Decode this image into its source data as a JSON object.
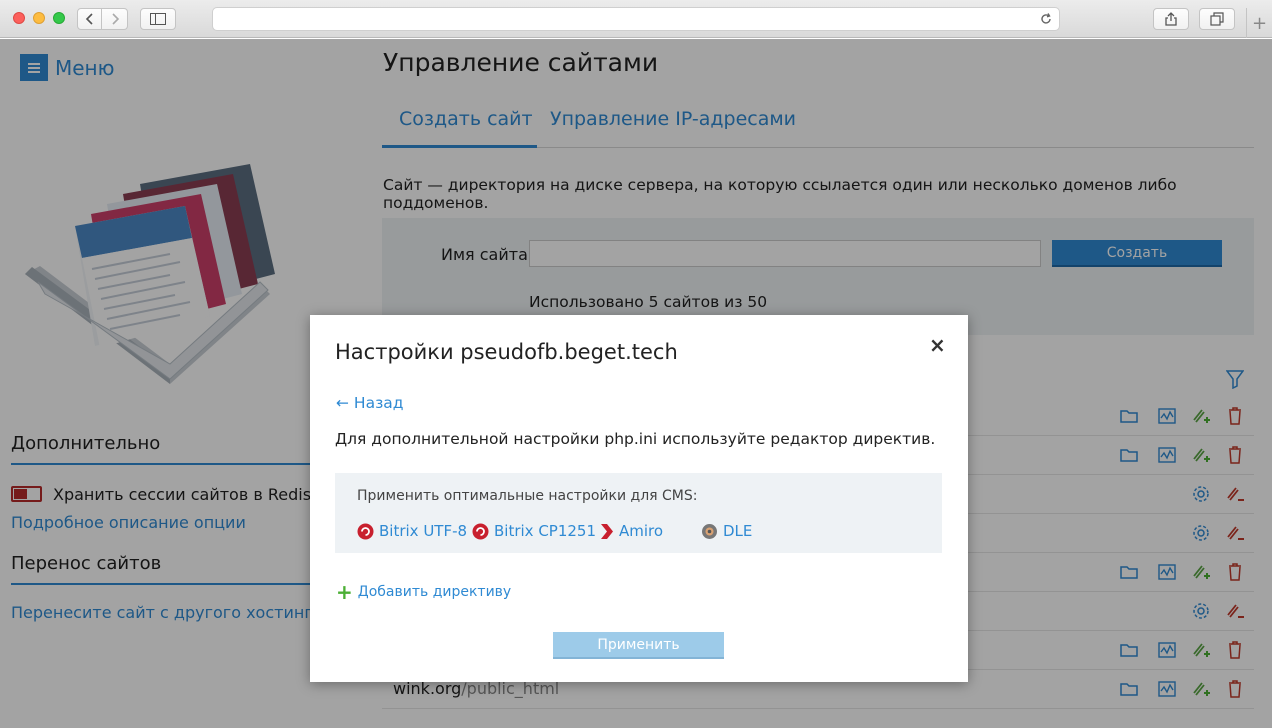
{
  "browser": {
    "address": "",
    "icons": [
      "back-icon",
      "forward-icon",
      "sidebar-icon",
      "reload-icon",
      "share-icon",
      "tabs-icon",
      "new-tab-icon"
    ]
  },
  "sidebar": {
    "menu_label": "Меню",
    "extra_heading": "Дополнительно",
    "redis_label": "Хранить сессии сайтов в Redis",
    "redis_link": "Подробное описание опции",
    "transfer_heading": "Перенос сайтов",
    "transfer_link": "Перенесите сайт с другого хостинга"
  },
  "main": {
    "title": "Управление сайтами",
    "tabs": [
      {
        "label": "Создать сайт",
        "active": true
      },
      {
        "label": "Управление IP-адресами",
        "active": false
      }
    ],
    "description": "Сайт — директория на диске сервера, на которую ссылается один или несколько доменов либо поддоменов.",
    "site_name_label": "Имя сайта:",
    "site_name_value": "",
    "create_button": "Создать",
    "usage": "Использовано 5 сайтов из 50",
    "rows": [
      {
        "name": "",
        "path": "",
        "icons": [
          "folder-icon",
          "stats-icon",
          "add-domain-icon",
          "delete-icon"
        ]
      },
      {
        "name": "",
        "path": "",
        "icons": [
          "folder-icon",
          "stats-icon",
          "add-domain-icon",
          "delete-icon"
        ]
      },
      {
        "name": "",
        "path": "",
        "icons": [
          "settings-icon",
          "remove-domain-icon"
        ]
      },
      {
        "name": "",
        "path": "",
        "icons": [
          "settings-icon",
          "remove-domain-icon"
        ]
      },
      {
        "name": "",
        "path": "",
        "icons": [
          "folder-icon",
          "stats-icon",
          "add-domain-icon",
          "delete-icon"
        ]
      },
      {
        "name": "",
        "path": "",
        "icons": [
          "settings-icon",
          "remove-domain-icon"
        ]
      },
      {
        "name": "",
        "path": "",
        "icons": [
          "folder-icon",
          "stats-icon",
          "add-domain-icon",
          "delete-icon"
        ]
      },
      {
        "name": "wink.org",
        "path": "/public_html",
        "icons": [
          "folder-icon",
          "stats-icon",
          "add-domain-icon",
          "delete-icon"
        ]
      }
    ]
  },
  "modal": {
    "title": "Настройки pseudofb.beget.tech",
    "close": "×",
    "back": "← Назад",
    "description": "Для дополнительной настройки php.ini используйте редактор директив.",
    "cms_label": "Применить оптимальные настройки для CMS:",
    "cms": [
      {
        "label": "Bitrix UTF-8",
        "icon": "bitrix-icon"
      },
      {
        "label": "Bitrix CP1251",
        "icon": "bitrix-icon"
      },
      {
        "label": "Amiro",
        "icon": "amiro-icon"
      },
      {
        "label": "DLE",
        "icon": "dle-icon"
      }
    ],
    "add_directive": "Добавить директиву",
    "apply_button": "Применить"
  },
  "colors": {
    "accent": "#2f8ad3",
    "danger": "#c0392b",
    "success": "#4caf35",
    "panel": "#eef2f5"
  }
}
